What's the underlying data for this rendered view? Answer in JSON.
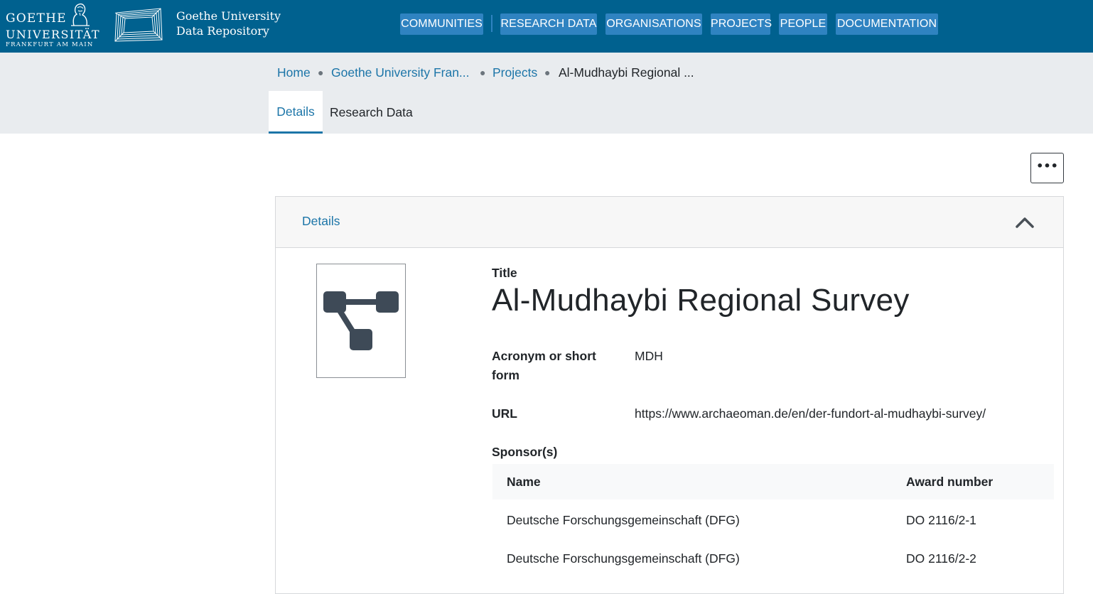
{
  "header": {
    "university_logo": {
      "line1": "GOETHE",
      "line2": "UNIVERSITÄT",
      "line3": "FRANKFURT AM MAIN"
    },
    "repository_name_line1": "Goethe University",
    "repository_name_line2": "Data Repository",
    "nav": [
      {
        "label": "COMMUNITIES"
      },
      {
        "label": "RESEARCH DATA"
      },
      {
        "label": "ORGANISATIONS"
      },
      {
        "label": "PROJECTS"
      },
      {
        "label": "PEOPLE"
      },
      {
        "label": "DOCUMENTATION"
      }
    ],
    "colors": {
      "bar": "#00618f",
      "nav_button": "#2f83c1"
    }
  },
  "breadcrumb": {
    "items": [
      "Home",
      "Goethe University Fran...",
      "Projects"
    ],
    "current": "Al-Mudhaybi Regional ..."
  },
  "tabs": [
    {
      "label": "Details",
      "active": true
    },
    {
      "label": "Research Data",
      "active": false
    }
  ],
  "actions": {
    "more_label": "•••"
  },
  "details_card": {
    "header_title": "Details",
    "collapse_icon": "chevron-up-icon",
    "image_icon": "project-network-icon",
    "title_label": "Title",
    "title_value": "Al-Mudhaybi Regional Survey",
    "acronym_label_line1": "Acronym or short",
    "acronym_label_line2": "form",
    "acronym_value": "MDH",
    "url_label": "URL",
    "url_value": "https://www.archaeoman.de/en/der-fundort-al-mudhaybi-survey/",
    "sponsors_label": "Sponsor(s)",
    "sponsors_table": {
      "columns": [
        "Name",
        "Award number"
      ],
      "rows": [
        {
          "name": "Deutsche Forschungsgemeinschaft (DFG)",
          "award": "DO 2116/2-1"
        },
        {
          "name": "Deutsche Forschungsgemeinschaft (DFG)",
          "award": "DO 2116/2-2"
        }
      ]
    }
  }
}
